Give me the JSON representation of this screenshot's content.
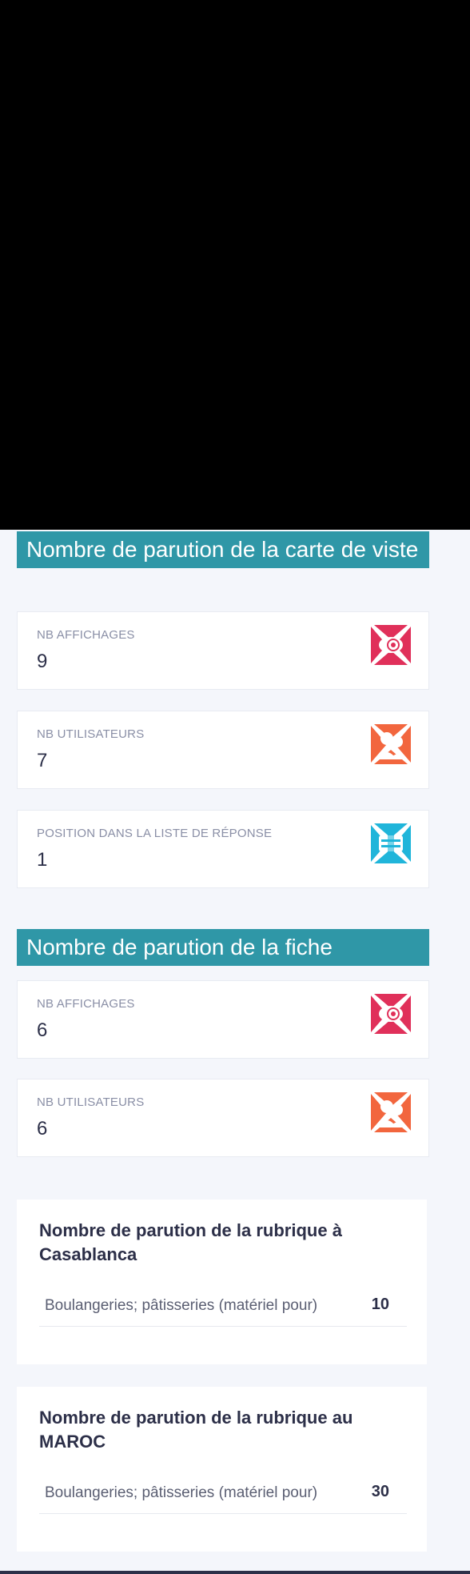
{
  "section_carte": {
    "title": "Nombre de parution de la carte de viste",
    "stats": [
      {
        "label": "NB AFFICHAGES",
        "value": "9",
        "icon": "eye-icon",
        "color": "#e0305a"
      },
      {
        "label": "NB UTILISATEURS",
        "value": "7",
        "icon": "users-icon",
        "color": "#f2663e"
      },
      {
        "label": "POSITION DANS LA LISTE DE RÉPONSE",
        "value": "1",
        "icon": "list-position-icon",
        "color": "#20b5da"
      }
    ]
  },
  "section_fiche": {
    "title": "Nombre de parution de la fiche",
    "stats": [
      {
        "label": "NB AFFICHAGES",
        "value": "6",
        "icon": "eye-icon",
        "color": "#e0305a"
      },
      {
        "label": "NB UTILISATEURS",
        "value": "6",
        "icon": "users-icon",
        "color": "#f2663e"
      }
    ]
  },
  "rubrique_casablanca": {
    "title": "Nombre de parution de la rubrique à Casablanca",
    "rows": [
      {
        "name": "Boulangeries; pâtisseries (matériel pour)",
        "count": "10"
      }
    ]
  },
  "rubrique_maroc": {
    "title": "Nombre de parution de la rubrique au MAROC",
    "rows": [
      {
        "name": "Boulangeries; pâtisseries (matériel pour)",
        "count": "30"
      }
    ]
  }
}
